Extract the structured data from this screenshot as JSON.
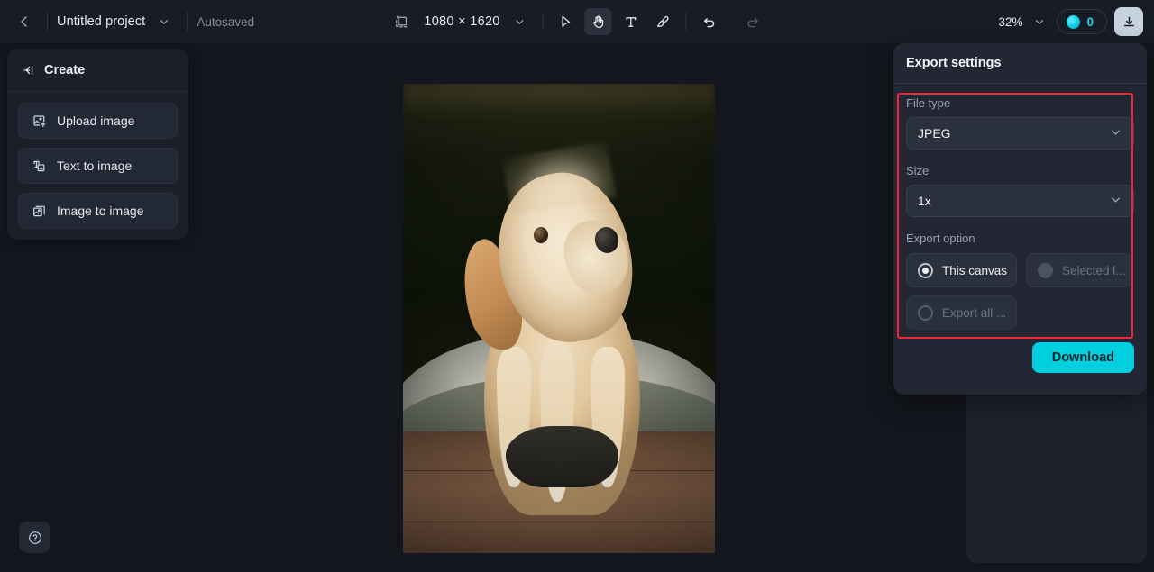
{
  "topbar": {
    "back_icon": "chevron-left-icon",
    "project_title": "Untitled project",
    "project_caret": "chevron-down-icon",
    "autosaved_label": "Autosaved",
    "frame_icon": "canvas-frame-icon",
    "canvas_dimensions": "1080 × 1620",
    "dimensions_caret": "chevron-down-icon",
    "tools": [
      {
        "name": "select-tool",
        "icon": "cursor-arrow-icon",
        "active": false
      },
      {
        "name": "hand-tool",
        "icon": "hand-icon",
        "active": true
      },
      {
        "name": "text-tool",
        "icon": "text-t-icon",
        "active": false
      },
      {
        "name": "brush-tool",
        "icon": "paintbrush-icon",
        "active": false
      }
    ],
    "undo_icon": "undo-arrow-icon",
    "redo_icon": "redo-arrow-icon",
    "zoom_level": "32%",
    "zoom_caret": "chevron-down-icon",
    "credits_icon": "credit-coin-icon",
    "credits_count": "0",
    "download_icon": "download-tray-icon"
  },
  "sidebar": {
    "collapse_icon": "collapse-panel-icon",
    "title": "Create",
    "items": [
      {
        "label": "Upload image",
        "icon": "image-upload-icon"
      },
      {
        "label": "Text to image",
        "icon": "text-to-image-icon"
      },
      {
        "label": "Image to image",
        "icon": "image-to-image-icon"
      }
    ]
  },
  "canvas": {
    "artwork_alt": "photograph of a cream colored puppy sitting on a cushion on a wooden floor"
  },
  "export_panel": {
    "title": "Export settings",
    "file_type": {
      "label": "File type",
      "value": "JPEG",
      "caret": "chevron-down-icon"
    },
    "size": {
      "label": "Size",
      "value": "1x",
      "caret": "chevron-down-icon"
    },
    "export_option": {
      "label": "Export option",
      "options": [
        {
          "label": "This canvas",
          "state": "selected"
        },
        {
          "label": "Selected l...",
          "state": "disabled"
        },
        {
          "label": "Export all ...",
          "state": "unselected"
        }
      ]
    },
    "download_button": "Download",
    "highlight_color": "#f42534"
  },
  "help": {
    "icon": "question-mark-circle-icon"
  },
  "colors": {
    "app_background": "#13161d",
    "topbar_background": "#181c25",
    "panel_background": "#222733",
    "sidebar_background": "#1a1f29",
    "accent_cyan": "#00cfe0",
    "highlight_red": "#f42534"
  }
}
